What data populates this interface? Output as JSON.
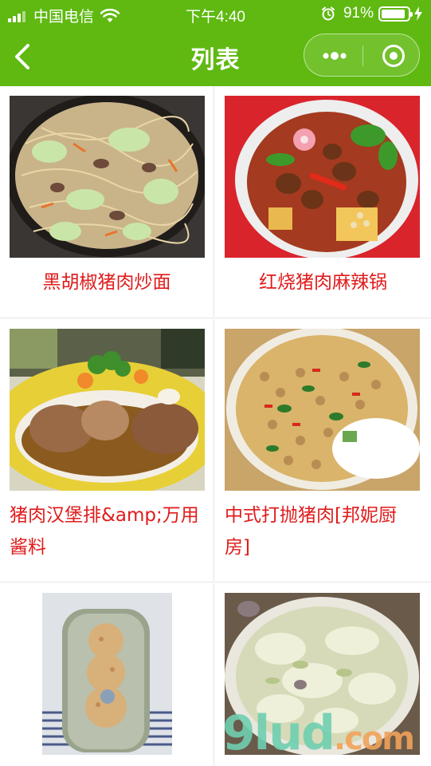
{
  "status_bar": {
    "carrier": "中国电信",
    "time": "下午4:40",
    "battery_percent": "91%",
    "battery_level": 0.91
  },
  "nav": {
    "title": "列表",
    "back_icon": "chevron-left-icon",
    "more_icon": "more-dots-icon",
    "close_icon": "target-circle-icon"
  },
  "colors": {
    "header_green": "#5fb911",
    "item_text_red": "#e01b1b"
  },
  "items": [
    {
      "name": "黑胡椒猪肉炒面"
    },
    {
      "name": "红烧猪肉麻辣锅"
    },
    {
      "name": "猪肉汉堡排&amp;万用酱料"
    },
    {
      "name": "中式打抛猪肉[邦妮厨房]"
    },
    {
      "name": ""
    },
    {
      "name": ""
    }
  ],
  "watermark": {
    "main": "9lud",
    "suffix": ".com"
  }
}
